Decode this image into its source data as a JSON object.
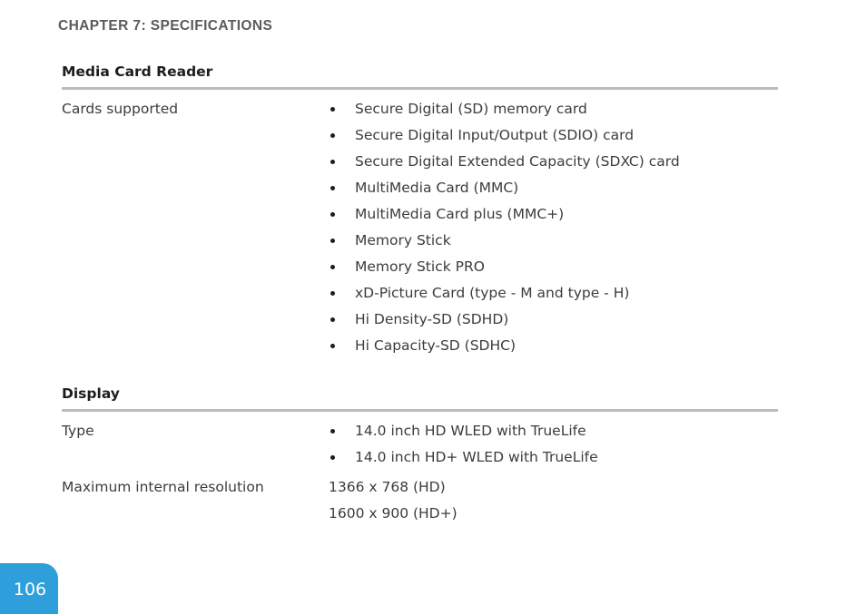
{
  "chapter": {
    "header": "CHAPTER 7: SPECIFICATIONS"
  },
  "colors": {
    "page_badge_blue": "#2f9fdb",
    "rule_gray": "#bcbcbc",
    "header_gray": "#5b5b5b",
    "body_text": "#3c3c3c",
    "heading_text": "#1d1d1d"
  },
  "sections": [
    {
      "title": "Media Card Reader",
      "rows": [
        {
          "label": "Cards supported",
          "bullets": [
            "Secure Digital (SD) memory card",
            "Secure Digital Input/Output (SDIO) card",
            "Secure Digital Extended Capacity (SDXC) card",
            "MultiMedia Card (MMC)",
            "MultiMedia Card plus (MMC+)",
            "Memory Stick",
            "Memory Stick PRO",
            "xD-Picture Card (type - M and type - H)",
            "Hi Density-SD (SDHD)",
            "Hi Capacity-SD (SDHC)"
          ]
        }
      ]
    },
    {
      "title": "Display",
      "rows": [
        {
          "label": "Type",
          "bullets": [
            "14.0 inch HD WLED with TrueLife",
            "14.0 inch HD+ WLED with TrueLife"
          ]
        },
        {
          "label": "Maximum internal resolution",
          "lines": [
            "1366 x 768 (HD)",
            "1600 x 900 (HD+)"
          ]
        }
      ]
    }
  ],
  "page_number": "106"
}
